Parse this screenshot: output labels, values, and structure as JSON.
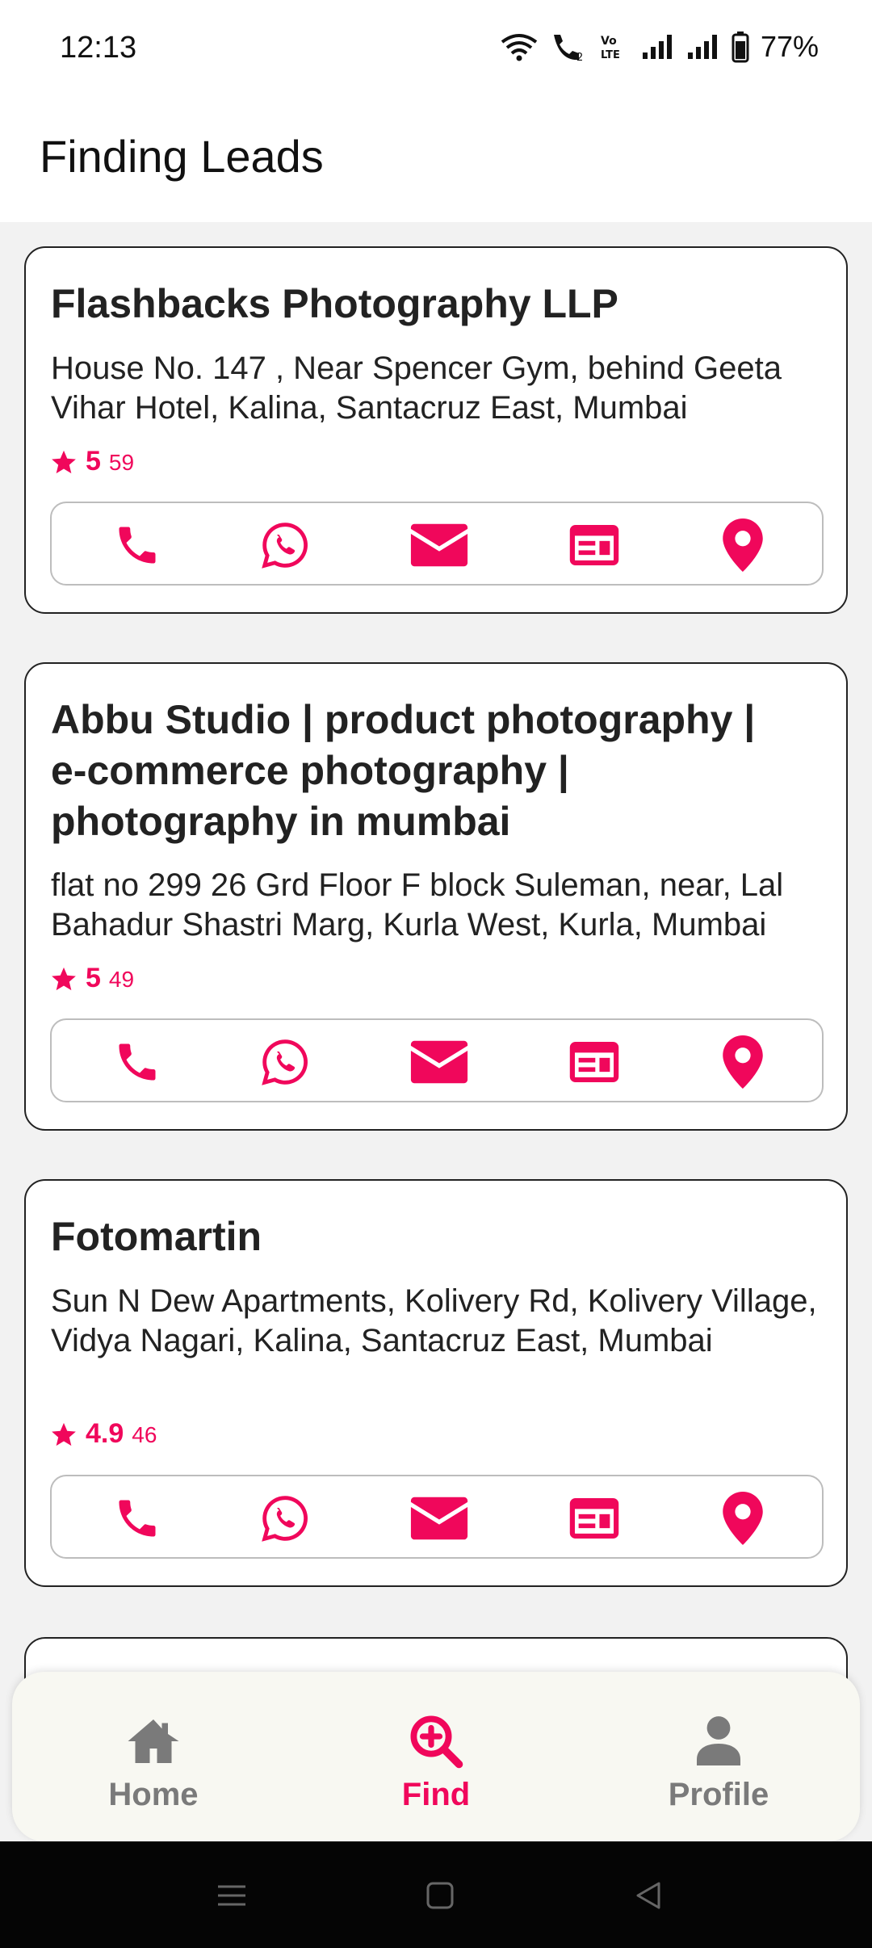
{
  "status": {
    "time": "12:13",
    "battery": "77%"
  },
  "app": {
    "title": "Finding Leads"
  },
  "colors": {
    "accent": "#f0075b",
    "muted": "#7a7a7a"
  },
  "leads": [
    {
      "name": "Flashbacks Photography LLP",
      "address": "House No. 147 , Near Spencer Gym, behind Geeta Vihar Hotel, Kalina, Santacruz East, Mumbai",
      "rating": "5",
      "reviews": "59"
    },
    {
      "name": "Abbu Studio | product photography | e-commerce photography | photography in mumbai",
      "address": "flat no 299 26 Grd Floor F block Suleman, near, Lal Bahadur Shastri Marg, Kurla West, Kurla, Mumbai",
      "rating": "5",
      "reviews": "49"
    },
    {
      "name": "Fotomartin",
      "address": "Sun N Dew Apartments, Kolivery Rd, Kolivery Village, Vidya Nagari, Kalina, Santacruz East, Mumbai",
      "rating": "4.9",
      "reviews": "46"
    }
  ],
  "actions": [
    "phone-icon",
    "whatsapp-icon",
    "email-icon",
    "website-icon",
    "location-icon"
  ],
  "nav": {
    "items": [
      {
        "label": "Home",
        "icon": "home-icon",
        "active": false
      },
      {
        "label": "Find",
        "icon": "search-plus-icon",
        "active": true
      },
      {
        "label": "Profile",
        "icon": "user-icon",
        "active": false
      }
    ]
  }
}
